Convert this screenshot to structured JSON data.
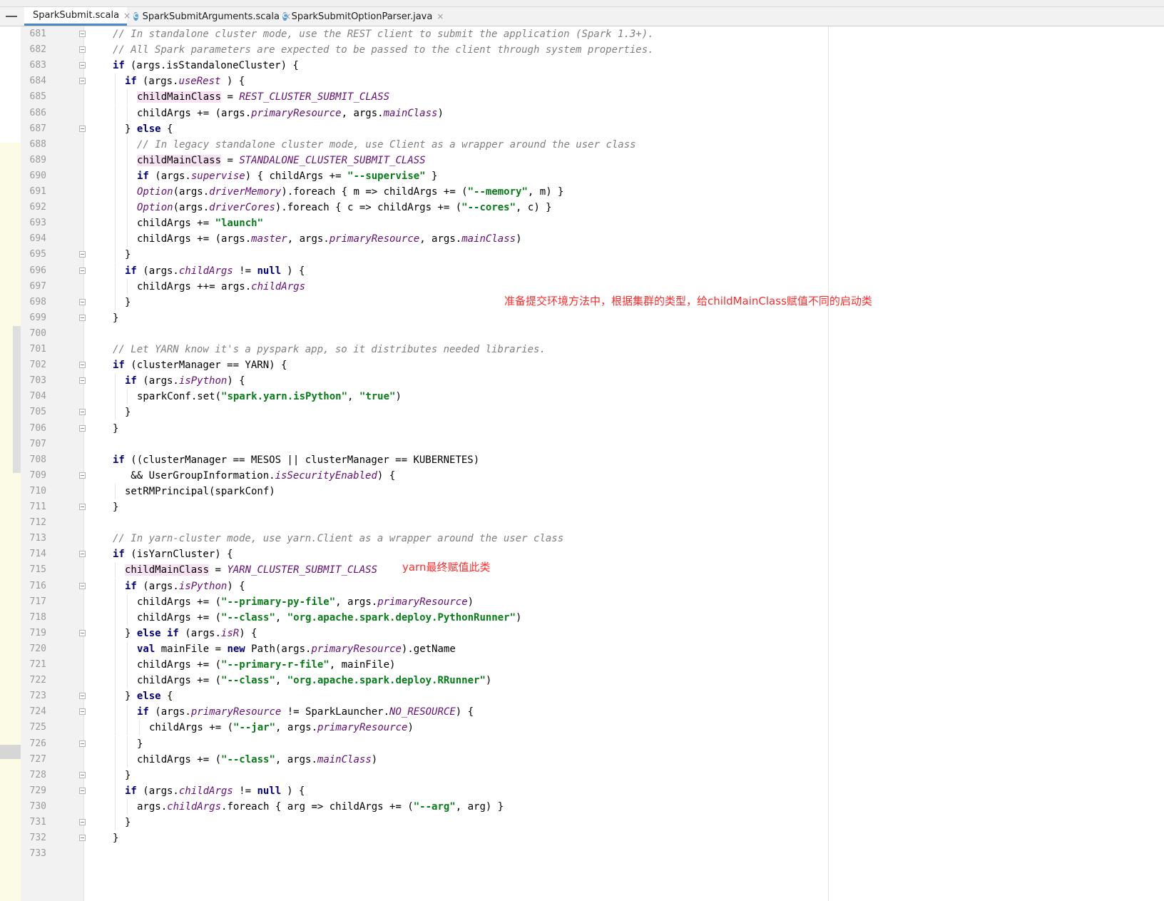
{
  "tabs": [
    {
      "label": "SparkSubmit.scala",
      "icon": "scala-file-icon",
      "active": true
    },
    {
      "label": "SparkSubmitArguments.scala",
      "icon": "scala-class-icon",
      "active": false
    },
    {
      "label": "SparkSubmitOptionParser.java",
      "icon": "java-class-icon",
      "active": false
    }
  ],
  "close_glyph": "×",
  "annotations": {
    "note1": "准备提交环境方法中，根据集群的类型，给childMainClass赋值不同的启动类",
    "note2": "yarn最终赋值此类"
  },
  "colors": {
    "keyword": "#000080",
    "comment": "#808080",
    "string": "#067d17",
    "field": "#660e7a",
    "annotation": "#ff2b2b",
    "highlight": "#f7e2f3"
  },
  "lines": [
    {
      "n": "681",
      "indent": 0,
      "fold": true,
      "tokens": [
        [
          "cm",
          "// In standalone cluster mode, use the REST client to submit the application (Spark 1.3+).",
          0
        ]
      ]
    },
    {
      "n": "682",
      "indent": 0,
      "fold": true,
      "tokens": [
        [
          "cm",
          "// All Spark parameters are expected to be passed to the client through system properties.",
          0
        ]
      ]
    },
    {
      "n": "683",
      "indent": 0,
      "fold": true,
      "tokens": [
        [
          "kw",
          "if",
          0
        ],
        [
          "",
          "(args.isStandaloneCluster) {",
          0
        ]
      ]
    },
    {
      "n": "684",
      "indent": 1,
      "fold": true,
      "tokens": [
        [
          "kw",
          "if",
          0
        ],
        [
          "",
          "(args.",
          0
        ],
        [
          "it",
          "useRest",
          1
        ],
        [
          "",
          " ) {",
          1
        ]
      ]
    },
    {
      "n": "685",
      "indent": 2,
      "fold": false,
      "tokens": [
        [
          "hl",
          "childMainClass",
          0
        ],
        [
          "",
          " = ",
          0
        ],
        [
          "it",
          "REST_CLUSTER_SUBMIT_CLASS",
          0
        ]
      ]
    },
    {
      "n": "686",
      "indent": 2,
      "fold": false,
      "tokens": [
        [
          "",
          "childArgs += (args.",
          0
        ],
        [
          "it",
          "primaryResource",
          0
        ],
        [
          "",
          ", args.",
          0
        ],
        [
          "it",
          "mainClass",
          0
        ],
        [
          "",
          ")",
          0
        ]
      ]
    },
    {
      "n": "687",
      "indent": 1,
      "fold": true,
      "tokens": [
        [
          "",
          "} ",
          0
        ],
        [
          "kw",
          "else",
          0
        ],
        [
          "",
          " {",
          0
        ]
      ]
    },
    {
      "n": "688",
      "indent": 2,
      "fold": false,
      "tokens": [
        [
          "cm",
          "// In legacy standalone cluster mode, use Client as a wrapper around the user class",
          0
        ]
      ]
    },
    {
      "n": "689",
      "indent": 2,
      "fold": false,
      "tokens": [
        [
          "hl",
          "childMainClass",
          0
        ],
        [
          "",
          " = ",
          0
        ],
        [
          "it",
          "STANDALONE_CLUSTER_SUBMIT_CLASS",
          0
        ]
      ]
    },
    {
      "n": "690",
      "indent": 2,
      "fold": false,
      "tokens": [
        [
          "kw",
          "if",
          0
        ],
        [
          "",
          " (args.",
          0
        ],
        [
          "it",
          "supervise",
          0
        ],
        [
          "",
          ") { childArgs += ",
          0
        ],
        [
          "st",
          "\"--supervise\"",
          0
        ],
        [
          "",
          " }",
          0
        ]
      ]
    },
    {
      "n": "691",
      "indent": 2,
      "fold": false,
      "tokens": [
        [
          "it",
          "Option",
          0
        ],
        [
          "",
          "(args.",
          0
        ],
        [
          "it",
          "driverMemory",
          0
        ],
        [
          "",
          ").foreach { m => childArgs += (",
          0
        ],
        [
          "st",
          "\"--memory\"",
          0
        ],
        [
          "",
          ", m) }",
          0
        ]
      ]
    },
    {
      "n": "692",
      "indent": 2,
      "fold": false,
      "tokens": [
        [
          "it",
          "Option",
          0
        ],
        [
          "",
          "(args.",
          0
        ],
        [
          "it",
          "driverCores",
          0
        ],
        [
          "",
          ").foreach { c => childArgs += (",
          0
        ],
        [
          "st",
          "\"--cores\"",
          0
        ],
        [
          "",
          ", c) }",
          0
        ]
      ]
    },
    {
      "n": "693",
      "indent": 2,
      "fold": false,
      "tokens": [
        [
          "",
          "childArgs += ",
          0
        ],
        [
          "st",
          "\"launch\"",
          0
        ]
      ]
    },
    {
      "n": "694",
      "indent": 2,
      "fold": false,
      "tokens": [
        [
          "",
          "childArgs += (args.",
          0
        ],
        [
          "it",
          "master",
          0
        ],
        [
          "",
          ", args.",
          0
        ],
        [
          "it",
          "primaryResource",
          0
        ],
        [
          "",
          ", args.",
          0
        ],
        [
          "it",
          "mainClass",
          0
        ],
        [
          "",
          ")",
          0
        ]
      ]
    },
    {
      "n": "695",
      "indent": 1,
      "fold": true,
      "tokens": [
        [
          "",
          "}",
          0
        ]
      ]
    },
    {
      "n": "696",
      "indent": 1,
      "fold": true,
      "tokens": [
        [
          "kw",
          "if",
          0
        ],
        [
          "",
          " (args.",
          0
        ],
        [
          "it",
          "childArgs",
          0
        ],
        [
          "",
          " != ",
          0
        ],
        [
          "kw",
          "null",
          0
        ],
        [
          "",
          ") {",
          0
        ]
      ]
    },
    {
      "n": "697",
      "indent": 2,
      "fold": false,
      "tokens": [
        [
          "",
          "childArgs ++= args.",
          0
        ],
        [
          "it",
          "childArgs",
          0
        ]
      ]
    },
    {
      "n": "698",
      "indent": 1,
      "fold": true,
      "tokens": [
        [
          "",
          "}",
          0
        ]
      ]
    },
    {
      "n": "699",
      "indent": 0,
      "fold": true,
      "tokens": [
        [
          "",
          "}",
          0
        ]
      ]
    },
    {
      "n": "700",
      "indent": 0,
      "fold": false,
      "tokens": []
    },
    {
      "n": "701",
      "indent": 0,
      "fold": false,
      "tokens": [
        [
          "cm",
          "// Let YARN know it's a pyspark app, so it distributes needed libraries.",
          0
        ]
      ]
    },
    {
      "n": "702",
      "indent": 0,
      "fold": true,
      "tokens": [
        [
          "kw",
          "if",
          0
        ],
        [
          "",
          " (clusterManager == YARN) {",
          0
        ]
      ]
    },
    {
      "n": "703",
      "indent": 1,
      "fold": true,
      "tokens": [
        [
          "kw",
          "if",
          0
        ],
        [
          "",
          " (args.",
          0
        ],
        [
          "it",
          "isPython",
          0
        ],
        [
          "",
          ") {",
          0
        ]
      ]
    },
    {
      "n": "704",
      "indent": 2,
      "fold": false,
      "tokens": [
        [
          "",
          "sparkConf.set(",
          0
        ],
        [
          "st",
          "\"spark.yarn.isPython\"",
          0
        ],
        [
          "",
          ", ",
          0
        ],
        [
          "st",
          "\"true\"",
          0
        ],
        [
          "",
          ")",
          0
        ]
      ]
    },
    {
      "n": "705",
      "indent": 1,
      "fold": true,
      "tokens": [
        [
          "",
          "}",
          0
        ]
      ]
    },
    {
      "n": "706",
      "indent": 0,
      "fold": true,
      "tokens": [
        [
          "",
          "}",
          0
        ]
      ]
    },
    {
      "n": "707",
      "indent": 0,
      "fold": false,
      "tokens": []
    },
    {
      "n": "708",
      "indent": 0,
      "fold": false,
      "tokens": [
        [
          "kw",
          "if",
          0
        ],
        [
          "",
          " ((clusterManager == MESOS || clusterManager == KUBERNETES)",
          0
        ]
      ]
    },
    {
      "n": "709",
      "indent": 0,
      "fold": true,
      "tokens": [
        [
          "",
          "   && UserGroupInformation.",
          0
        ],
        [
          "it",
          "isSecurityEnabled",
          0
        ],
        [
          "",
          ") {",
          0
        ]
      ]
    },
    {
      "n": "710",
      "indent": 1,
      "fold": false,
      "tokens": [
        [
          "",
          "setRMPrincipal(sparkConf)",
          0
        ]
      ]
    },
    {
      "n": "711",
      "indent": 0,
      "fold": true,
      "tokens": [
        [
          "",
          "}",
          0
        ]
      ]
    },
    {
      "n": "712",
      "indent": 0,
      "fold": false,
      "tokens": []
    },
    {
      "n": "713",
      "indent": 0,
      "fold": false,
      "tokens": [
        [
          "cm",
          "// In yarn-cluster mode, use yarn.Client as a wrapper around the user class",
          0
        ]
      ]
    },
    {
      "n": "714",
      "indent": 0,
      "fold": true,
      "tokens": [
        [
          "kw",
          "if",
          0
        ],
        [
          "",
          " (isYarnCluster) {",
          0
        ]
      ]
    },
    {
      "n": "715",
      "indent": 1,
      "fold": false,
      "tokens": [
        [
          "hl",
          "childMainClass",
          0
        ],
        [
          "",
          " = ",
          0
        ],
        [
          "it",
          "YARN_CLUSTER_SUBMIT_CLASS",
          0
        ]
      ]
    },
    {
      "n": "716",
      "indent": 1,
      "fold": true,
      "tokens": [
        [
          "kw",
          "if",
          0
        ],
        [
          "",
          " (args.",
          0
        ],
        [
          "it",
          "isPython",
          0
        ],
        [
          "",
          ") {",
          0
        ]
      ]
    },
    {
      "n": "717",
      "indent": 2,
      "fold": false,
      "tokens": [
        [
          "",
          "childArgs += (",
          0
        ],
        [
          "st",
          "\"--primary-py-file\"",
          0
        ],
        [
          "",
          ", args.",
          0
        ],
        [
          "it",
          "primaryResource",
          0
        ],
        [
          "",
          ")",
          0
        ]
      ]
    },
    {
      "n": "718",
      "indent": 2,
      "fold": false,
      "tokens": [
        [
          "",
          "childArgs += (",
          0
        ],
        [
          "st",
          "\"--class\"",
          0
        ],
        [
          "",
          ", ",
          0
        ],
        [
          "st",
          "\"org.apache.spark.deploy.PythonRunner\"",
          0
        ],
        [
          "",
          ")",
          0
        ]
      ]
    },
    {
      "n": "719",
      "indent": 1,
      "fold": true,
      "tokens": [
        [
          "",
          "} ",
          0
        ],
        [
          "kw",
          "else if",
          0
        ],
        [
          "",
          " (args.",
          0
        ],
        [
          "it",
          "isR",
          0
        ],
        [
          "",
          ") {",
          0
        ]
      ]
    },
    {
      "n": "720",
      "indent": 2,
      "fold": false,
      "tokens": [
        [
          "kw",
          "val",
          0
        ],
        [
          "",
          " mainFile = ",
          0
        ],
        [
          "kw",
          "new",
          0
        ],
        [
          "",
          " Path(args.",
          0
        ],
        [
          "it",
          "primaryResource",
          0
        ],
        [
          "",
          ").getName",
          0
        ]
      ]
    },
    {
      "n": "721",
      "indent": 2,
      "fold": false,
      "tokens": [
        [
          "",
          "childArgs += (",
          0
        ],
        [
          "st",
          "\"--primary-r-file\"",
          0
        ],
        [
          "",
          ", mainFile)",
          0
        ]
      ]
    },
    {
      "n": "722",
      "indent": 2,
      "fold": false,
      "tokens": [
        [
          "",
          "childArgs += (",
          0
        ],
        [
          "st",
          "\"--class\"",
          0
        ],
        [
          "",
          ", ",
          0
        ],
        [
          "st",
          "\"org.apache.spark.deploy.RRunner\"",
          0
        ],
        [
          "",
          ")",
          0
        ]
      ]
    },
    {
      "n": "723",
      "indent": 1,
      "fold": true,
      "tokens": [
        [
          "",
          "} ",
          0
        ],
        [
          "kw",
          "else",
          0
        ],
        [
          "",
          " {",
          0
        ]
      ]
    },
    {
      "n": "724",
      "indent": 2,
      "fold": true,
      "tokens": [
        [
          "kw",
          "if",
          0
        ],
        [
          "",
          " (args.",
          0
        ],
        [
          "it",
          "primaryResource",
          0
        ],
        [
          "",
          " != SparkLauncher.",
          0
        ],
        [
          "it",
          "NO_RESOURCE",
          0
        ],
        [
          "",
          ") {",
          0
        ]
      ]
    },
    {
      "n": "725",
      "indent": 3,
      "fold": false,
      "tokens": [
        [
          "",
          "childArgs += (",
          0
        ],
        [
          "st",
          "\"--jar\"",
          0
        ],
        [
          "",
          ", args.",
          0
        ],
        [
          "it",
          "primaryResource",
          0
        ],
        [
          "",
          ")",
          0
        ]
      ]
    },
    {
      "n": "726",
      "indent": 2,
      "fold": true,
      "tokens": [
        [
          "",
          "}",
          0
        ]
      ]
    },
    {
      "n": "727",
      "indent": 2,
      "fold": false,
      "tokens": [
        [
          "",
          "childArgs += (",
          0
        ],
        [
          "st",
          "\"--class\"",
          0
        ],
        [
          "",
          ", args.",
          0
        ],
        [
          "it",
          "mainClass",
          0
        ],
        [
          "",
          ")",
          0
        ]
      ]
    },
    {
      "n": "728",
      "indent": 1,
      "fold": true,
      "tokens": [
        [
          "",
          "}",
          0
        ]
      ]
    },
    {
      "n": "729",
      "indent": 1,
      "fold": true,
      "tokens": [
        [
          "kw",
          "if",
          0
        ],
        [
          "",
          " (args.",
          0
        ],
        [
          "it",
          "childArgs",
          0
        ],
        [
          "",
          " != ",
          0
        ],
        [
          "kw",
          "null",
          0
        ],
        [
          "",
          ") {",
          0
        ]
      ]
    },
    {
      "n": "730",
      "indent": 2,
      "fold": false,
      "tokens": [
        [
          "",
          "args.",
          0
        ],
        [
          "it",
          "childArgs",
          0
        ],
        [
          "",
          ".foreach { arg => childArgs += (",
          0
        ],
        [
          "st",
          "\"--arg\"",
          0
        ],
        [
          "",
          ", arg) }",
          0
        ]
      ]
    },
    {
      "n": "731",
      "indent": 1,
      "fold": true,
      "tokens": [
        [
          "",
          "}",
          0
        ]
      ]
    },
    {
      "n": "732",
      "indent": 0,
      "fold": true,
      "tokens": [
        [
          "",
          "}",
          0
        ]
      ]
    },
    {
      "n": "733",
      "indent": 0,
      "fold": false,
      "tokens": []
    }
  ]
}
